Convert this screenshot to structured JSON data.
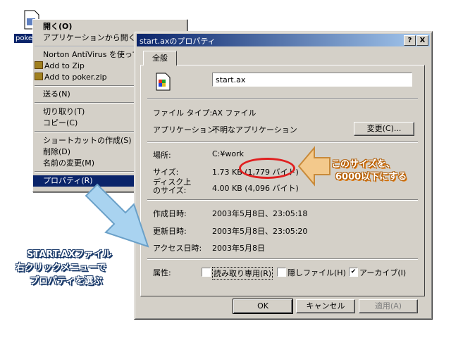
{
  "desktop": {
    "file_label": "poker",
    "icon": "file-icon"
  },
  "context_menu": {
    "items": [
      {
        "label": "開く(O)",
        "bold": true
      },
      {
        "label": "アプリケーションから開く(H)..."
      },
      {
        "label": "Norton AntiVirus を使って..."
      },
      {
        "label": "Add to Zip",
        "icon": "zip-icon"
      },
      {
        "label": "Add to poker.zip",
        "icon": "zip-icon"
      },
      {
        "label": "送る(N)"
      },
      {
        "label": "切り取り(T)"
      },
      {
        "label": "コピー(C)"
      },
      {
        "label": "ショートカットの作成(S)"
      },
      {
        "label": "削除(D)"
      },
      {
        "label": "名前の変更(M)"
      },
      {
        "label": "プロパティ(R)",
        "selected": true
      }
    ]
  },
  "dialog": {
    "title": "start.axのプロパティ",
    "help_btn": "?",
    "close_btn": "X",
    "tab": "全般",
    "file_name": "start.ax",
    "file_type_label": "ファイル タイプ:",
    "file_type_value": "AX ファイル",
    "app_label": "アプリケーション:",
    "app_value": "不明なアプリケーション",
    "change_btn": "変更(C)...",
    "location_label": "場所:",
    "location_value": "C:¥work",
    "size_label": "サイズ:",
    "size_value": "1.73 KB (1,779 バイト)",
    "disk_size_label_1": "ディスク上",
    "disk_size_label_2": "のサイズ:",
    "disk_size_value": "4.00 KB (4,096 バイト)",
    "created_label": "作成日時:",
    "created_value": "2003年5月8日、23:05:18",
    "modified_label": "更新日時:",
    "modified_value": "2003年5月8日、23:05:20",
    "accessed_label": "アクセス日時:",
    "accessed_value": "2003年5月8日",
    "attr_label": "属性:",
    "readonly_label": "読み取り専用(R)",
    "hidden_label": "隠しファイル(H)",
    "archive_label": "アーカイブ(I)",
    "archive_check": "✔",
    "ok_btn": "OK",
    "cancel_btn": "キャンセル",
    "apply_btn": "適用(A)"
  },
  "annotations": {
    "left_note_1": "START.AXファイル",
    "left_note_2": "右クリックメニューで",
    "left_note_3": "プロパティを選ぶ",
    "right_note_1": "このサイズを、",
    "right_note_2": "6000以下にする"
  },
  "colors": {
    "titlebar": "#0a246a",
    "highlight": "#0a246a",
    "arrow_blue": "#a9d3f0",
    "arrow_orange": "#f0c080",
    "ellipse": "#e02020"
  }
}
